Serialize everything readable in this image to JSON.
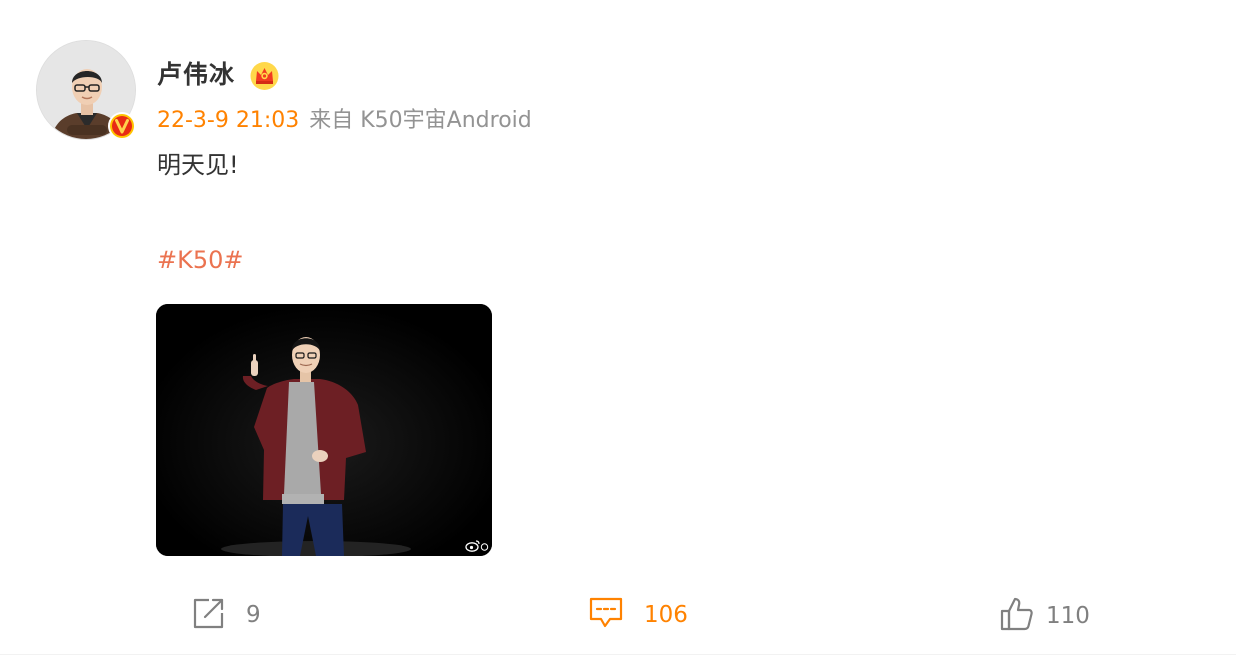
{
  "author": {
    "name": "卢伟冰",
    "verified_icon": "verified-v-badge",
    "member_icon": "crown-icon"
  },
  "post": {
    "timestamp": "22-3-9 21:03",
    "source": "来自 K50宇宙Android",
    "text": "明天见!",
    "hashtag": "#K50#"
  },
  "actions": {
    "repost_count": "9",
    "comment_count": "106",
    "like_count": "110"
  },
  "colors": {
    "accent_orange": "#ff8200",
    "hashtag": "#eb7350",
    "text_primary": "#333333",
    "text_secondary": "#939393",
    "icon_gray": "#808080"
  }
}
